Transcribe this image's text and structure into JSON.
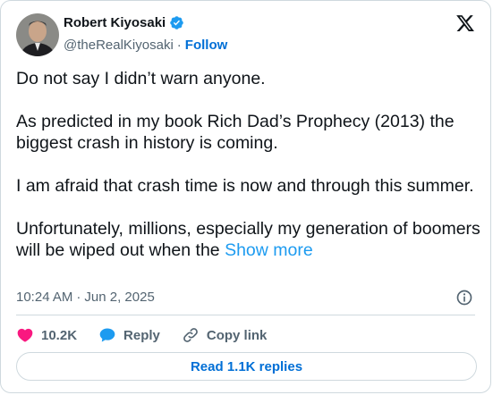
{
  "author": {
    "name": "Robert Kiyosaki",
    "handle": "@theRealKiyosaki",
    "separator": "·",
    "follow_label": "Follow"
  },
  "tweet": {
    "paragraphs": [
      "Do not say I didn’t warn anyone.",
      "As predicted in my book Rich Dad’s Prophecy (2013) the biggest crash in history is coming.",
      "I am afraid that crash time is now and through this summer.",
      "Unfortunately, millions, especially my generation of boomers will be wiped out when the"
    ],
    "show_more_label": "Show more"
  },
  "meta": {
    "time": "10:24 AM",
    "separator": "·",
    "date": "Jun 2, 2025"
  },
  "actions": {
    "like_count": "10.2K",
    "reply_label": "Reply",
    "copy_link_label": "Copy link"
  },
  "replies_button_label": "Read 1.1K replies",
  "colors": {
    "link": "#1d9bf0",
    "follow": "#006fd6",
    "like": "#f91880",
    "secondary": "#536471",
    "border": "#cfd9de"
  },
  "icons": [
    "verified-badge-icon",
    "x-logo-icon",
    "info-icon",
    "heart-icon",
    "reply-bubble-icon",
    "link-icon"
  ]
}
